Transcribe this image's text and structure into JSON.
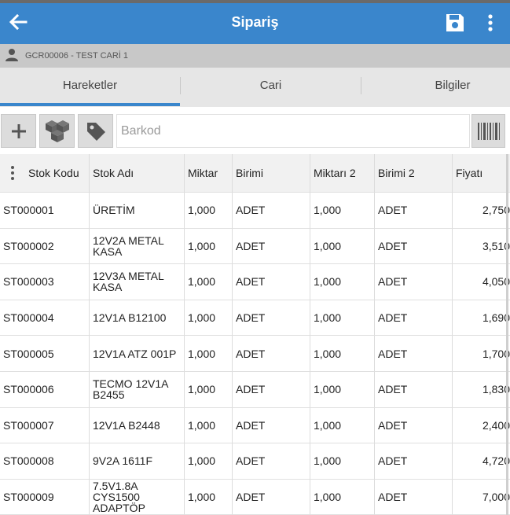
{
  "appbar": {
    "title": "Sipariş"
  },
  "cari": {
    "text": "GCR00006 - TEST CARİ 1"
  },
  "tabs": [
    {
      "label": "Hareketler",
      "active": true
    },
    {
      "label": "Cari",
      "active": false
    },
    {
      "label": "Bilgiler",
      "active": false
    }
  ],
  "toolbar": {
    "barcode_placeholder": "Barkod"
  },
  "table": {
    "columns": [
      "Stok Kodu",
      "Stok Adı",
      "Miktar",
      "Birimi",
      "Miktarı 2",
      "Birimi 2",
      "Fiyatı"
    ],
    "rows": [
      {
        "code": "ST000001",
        "name": "ÜRETİM",
        "qty": "1,000",
        "unit": "ADET",
        "qty2": "1,000",
        "unit2": "ADET",
        "price": "2,750"
      },
      {
        "code": "ST000002",
        "name": "12V2A METAL KASA",
        "qty": "1,000",
        "unit": "ADET",
        "qty2": "1,000",
        "unit2": "ADET",
        "price": "3,510"
      },
      {
        "code": "ST000003",
        "name": "12V3A METAL KASA",
        "qty": "1,000",
        "unit": "ADET",
        "qty2": "1,000",
        "unit2": "ADET",
        "price": "4,050"
      },
      {
        "code": "ST000004",
        "name": "12V1A B12100",
        "qty": "1,000",
        "unit": "ADET",
        "qty2": "1,000",
        "unit2": "ADET",
        "price": "1,690"
      },
      {
        "code": "ST000005",
        "name": "12V1A ATZ 001P",
        "qty": "1,000",
        "unit": "ADET",
        "qty2": "1,000",
        "unit2": "ADET",
        "price": "1,700"
      },
      {
        "code": "ST000006",
        "name": "TECMO 12V1A B2455",
        "qty": "1,000",
        "unit": "ADET",
        "qty2": "1,000",
        "unit2": "ADET",
        "price": "1,830"
      },
      {
        "code": "ST000007",
        "name": "12V1A B2448",
        "qty": "1,000",
        "unit": "ADET",
        "qty2": "1,000",
        "unit2": "ADET",
        "price": "2,400"
      },
      {
        "code": "ST000008",
        "name": "9V2A 1611F",
        "qty": "1,000",
        "unit": "ADET",
        "qty2": "1,000",
        "unit2": "ADET",
        "price": "4,720"
      },
      {
        "code": "ST000009",
        "name": "7.5V1.8A CYS1500 ADAPTÖP",
        "qty": "1,000",
        "unit": "ADET",
        "qty2": "1,000",
        "unit2": "ADET",
        "price": "7,000"
      }
    ]
  },
  "colors": {
    "appbar": "#3a86cc",
    "tab_underline": "#3a86cc",
    "cari_bar": "#c8c8c8",
    "tabs_bg": "#e6e6e6"
  },
  "icons": [
    "back-arrow-icon",
    "save-icon",
    "more-vert-icon",
    "person-icon",
    "add-icon",
    "cubes-icon",
    "tag-icon",
    "barcode-icon",
    "column-menu-icon"
  ]
}
